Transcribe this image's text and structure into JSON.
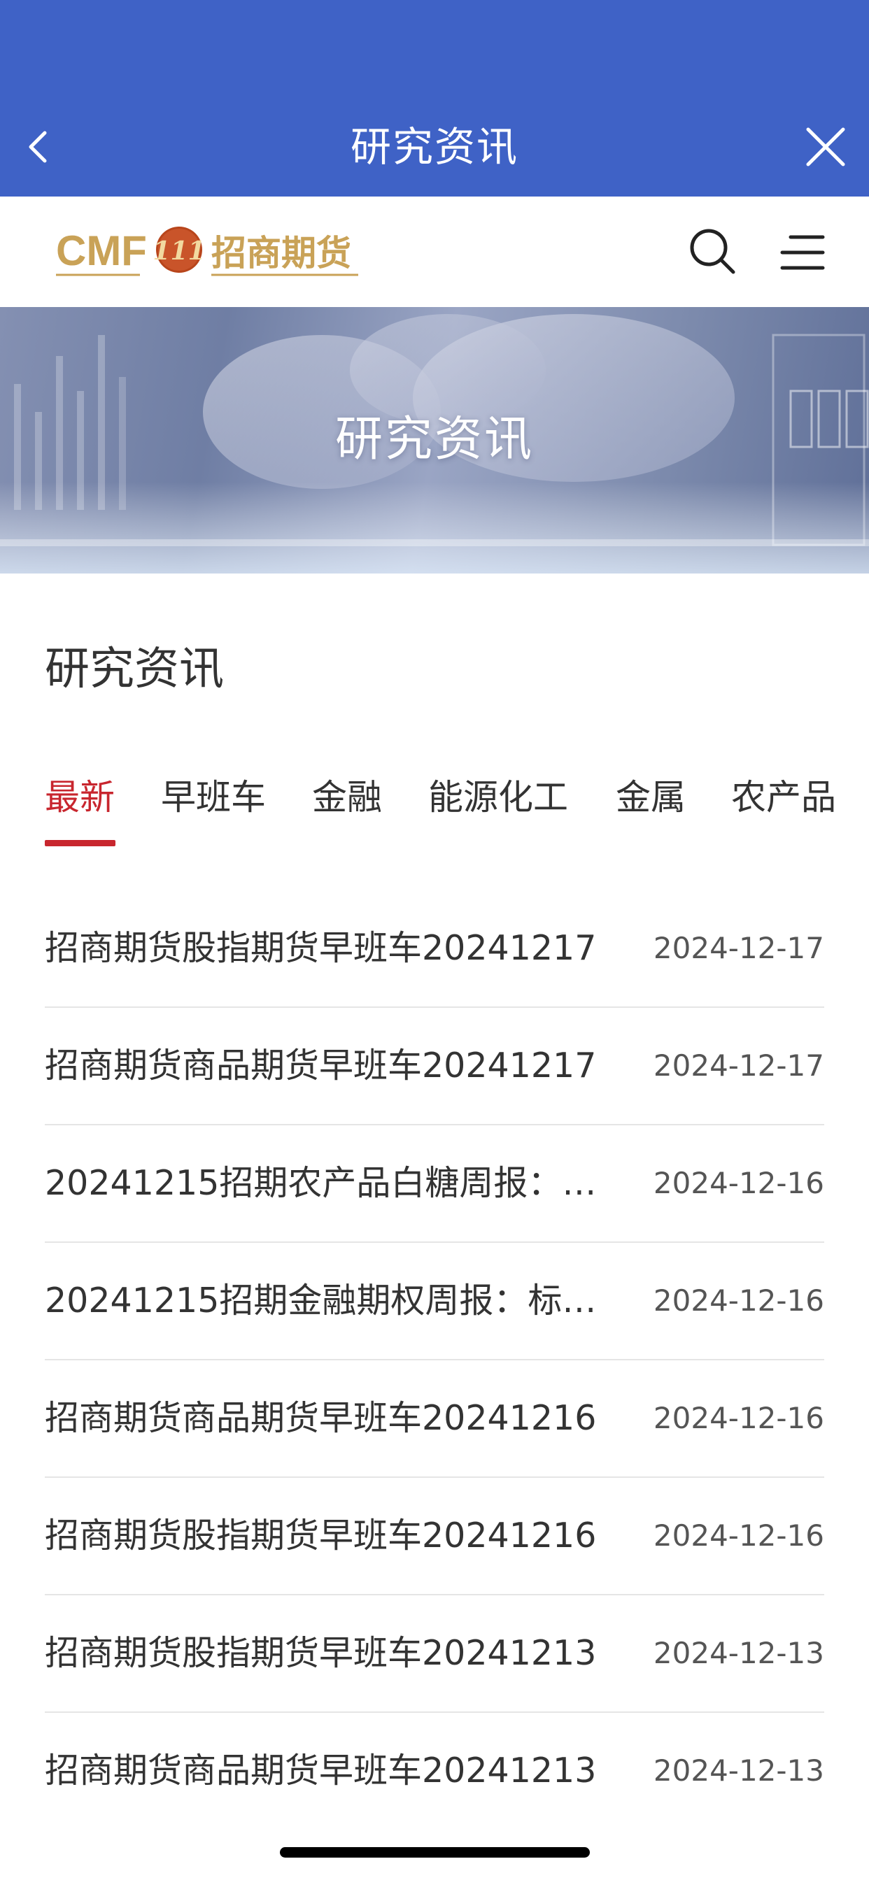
{
  "topbar": {
    "title": "研究资讯",
    "back_icon": "chevron-left-icon",
    "close_icon": "close-icon",
    "background": "#3f62c6"
  },
  "header": {
    "logo": {
      "latin": "CMF",
      "emblem": "111",
      "chinese": "招商期货"
    },
    "search_icon": "search-icon",
    "menu_icon": "menu-icon"
  },
  "banner": {
    "title": "研究资讯"
  },
  "section": {
    "title": "研究资讯"
  },
  "tabs": [
    {
      "label": "最新",
      "active": true
    },
    {
      "label": "早班车",
      "active": false
    },
    {
      "label": "金融",
      "active": false
    },
    {
      "label": "能源化工",
      "active": false
    },
    {
      "label": "金属",
      "active": false
    },
    {
      "label": "农产品",
      "active": false
    }
  ],
  "articles": [
    {
      "title": "招商期货股指期货早班车20241217",
      "date": "2024-12-17"
    },
    {
      "title": "招商期货商品期货早班车20241217",
      "date": "2024-12-17"
    },
    {
      "title": "20241215招期农产品白糖周报：…",
      "date": "2024-12-16"
    },
    {
      "title": "20241215招期金融期权周报：标…",
      "date": "2024-12-16"
    },
    {
      "title": "招商期货商品期货早班车20241216",
      "date": "2024-12-16"
    },
    {
      "title": "招商期货股指期货早班车20241216",
      "date": "2024-12-16"
    },
    {
      "title": "招商期货股指期货早班车20241213",
      "date": "2024-12-13"
    },
    {
      "title": "招商期货商品期货早班车20241213",
      "date": "2024-12-13"
    }
  ],
  "colors": {
    "accent_red": "#c8262e",
    "logo_gold": "#c9a257",
    "text": "#333333"
  }
}
